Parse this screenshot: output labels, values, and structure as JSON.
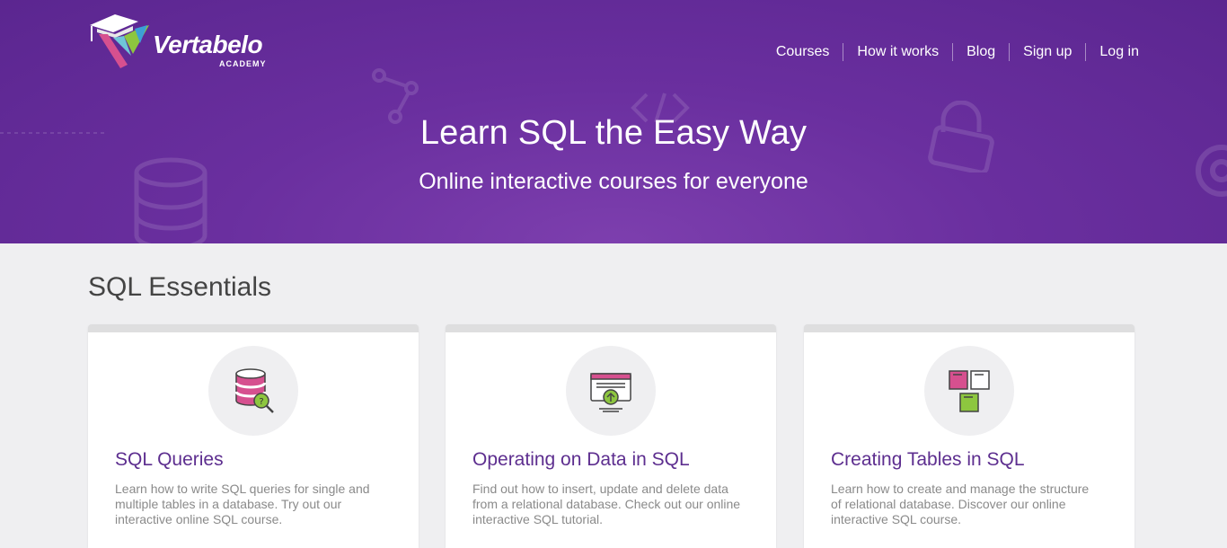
{
  "header": {
    "logo": {
      "brand": "Vertabelo",
      "sub": "ACADEMY"
    },
    "nav": [
      "Courses",
      "How it works",
      "Blog",
      "Sign up",
      "Log in"
    ]
  },
  "hero": {
    "title": "Learn SQL the Easy Way",
    "subtitle": "Online interactive courses for everyone"
  },
  "section": {
    "title": "SQL Essentials",
    "cards": [
      {
        "title": "SQL Queries",
        "description": "Learn how to write SQL queries for single and multiple tables in a database. Try out our interactive online SQL course.",
        "icon": "database-search-icon"
      },
      {
        "title": "Operating on Data in SQL",
        "description": "Find out how to insert, update and delete data from a relational database. Check out our online interactive SQL tutorial.",
        "icon": "browser-upload-icon"
      },
      {
        "title": "Creating Tables in SQL",
        "description": "Learn how to create and manage the structure of relational database. Discover our online interactive SQL course.",
        "icon": "tables-icon"
      }
    ]
  },
  "colors": {
    "hero_purple": "#6a2f9f",
    "card_title": "#5d2e8f",
    "accent_pink": "#d6508f",
    "accent_green": "#8dc63f"
  }
}
